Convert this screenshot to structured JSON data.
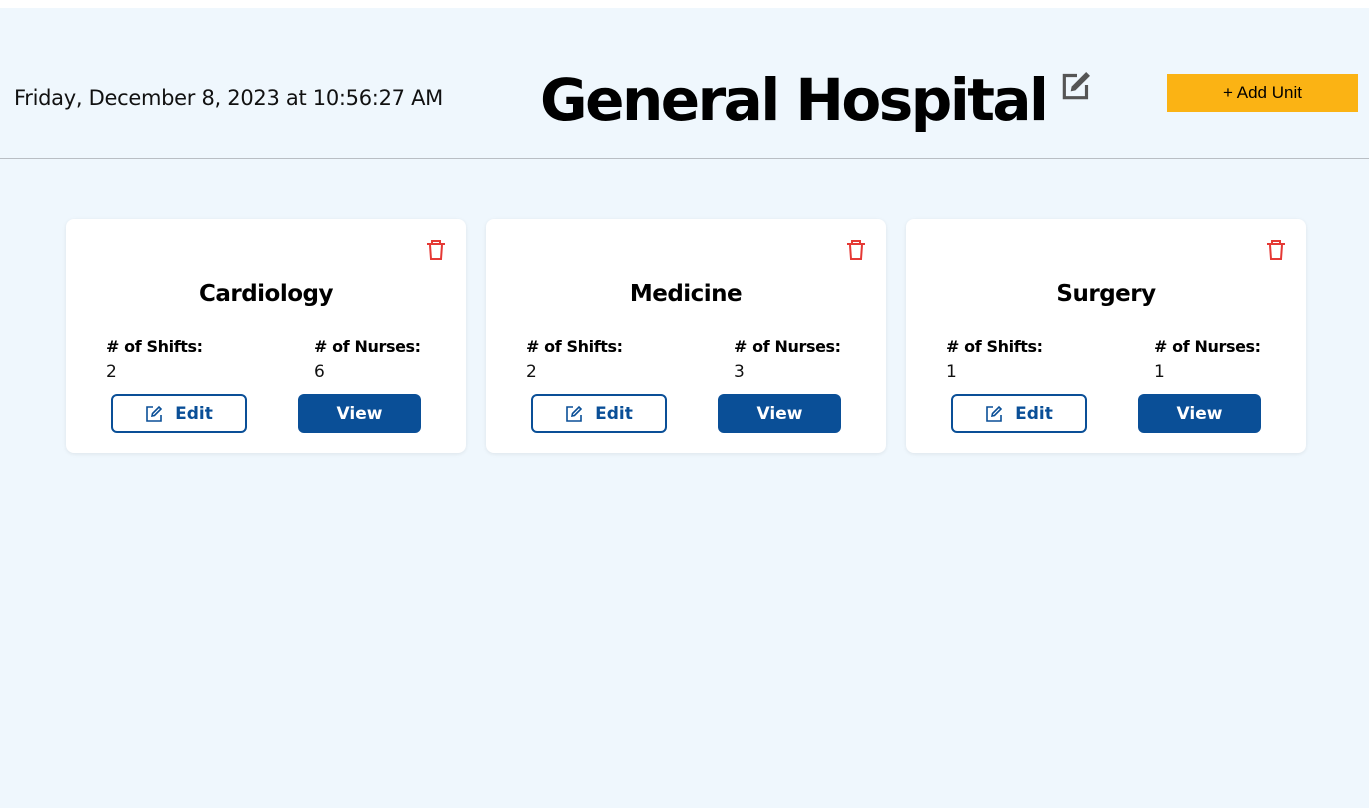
{
  "header": {
    "datetime": "Friday, December 8, 2023 at 10:56:27 AM",
    "title": "General Hospital",
    "add_unit_label": "+ Add Unit"
  },
  "colors": {
    "background": "#eff7fd",
    "accent_yellow": "#fbb314",
    "primary_blue": "#0a4f97",
    "delete_red": "#e53935"
  },
  "icons": {
    "title_edit": "edit-square-icon",
    "delete": "trash-icon",
    "edit": "edit-icon"
  },
  "labels": {
    "shifts": "# of Shifts:",
    "nurses": "# of Nurses:",
    "edit": "Edit",
    "view": "View"
  },
  "units": [
    {
      "name": "Cardiology",
      "shifts": "2",
      "nurses": "6"
    },
    {
      "name": "Medicine",
      "shifts": "2",
      "nurses": "3"
    },
    {
      "name": "Surgery",
      "shifts": "1",
      "nurses": "1"
    }
  ]
}
